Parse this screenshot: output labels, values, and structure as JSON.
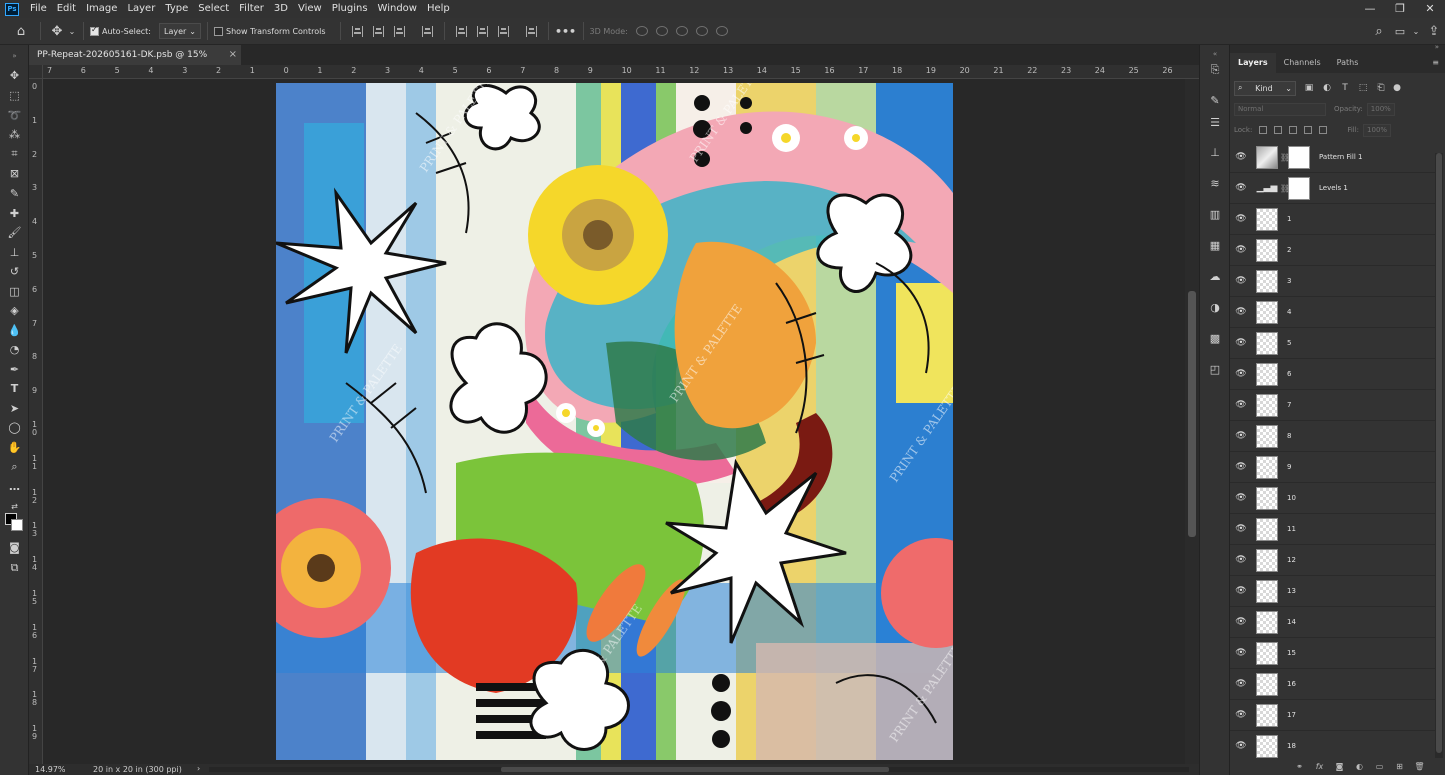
{
  "menu": {
    "logo": "Ps",
    "items": [
      "File",
      "Edit",
      "Image",
      "Layer",
      "Type",
      "Select",
      "Filter",
      "3D",
      "View",
      "Plugins",
      "Window",
      "Help"
    ],
    "window_controls": [
      "—",
      "❐",
      "✕"
    ]
  },
  "options_bar": {
    "auto_select_label": "Auto-Select:",
    "auto_select_checked": true,
    "auto_select_target": "Layer",
    "show_transform_label": "Show Transform Controls",
    "show_transform_checked": false,
    "mode_3d_label": "3D Mode:",
    "more_label": "•••"
  },
  "document": {
    "tab_title": "PP-Repeat-202605161-DK.psb @ 15% (RGB/8) *",
    "close_glyph": "×"
  },
  "rulers": {
    "top": [
      "7",
      "6",
      "5",
      "4",
      "3",
      "2",
      "1",
      "0",
      "1",
      "2",
      "3",
      "4",
      "5",
      "6",
      "7",
      "8",
      "9",
      "10",
      "11",
      "12",
      "13",
      "14",
      "15",
      "16",
      "17",
      "18",
      "19",
      "20",
      "21",
      "22",
      "23",
      "24",
      "25",
      "26"
    ],
    "left": [
      "0",
      "1",
      "2",
      "3",
      "4",
      "5",
      "6",
      "7",
      "8",
      "9",
      "1 0",
      "1 1",
      "1 2",
      "1 3",
      "1 4",
      "1 5",
      "1 6",
      "1 7",
      "1 8",
      "1 9"
    ]
  },
  "status": {
    "zoom": "14.97%",
    "doc_size": "20 in x 20 in (300 ppi)",
    "arrow": "›"
  },
  "layers_panel": {
    "tabs": [
      "Layers",
      "Channels",
      "Paths"
    ],
    "active_tab": "Layers",
    "kind_label": "Kind",
    "blend_mode": "Normal",
    "opacity_label": "Opacity:",
    "opacity_value": "100%",
    "lock_label": "Lock:",
    "fill_label": "Fill:",
    "fill_value": "100%",
    "layers": [
      {
        "name": "Pattern Fill 1",
        "kind": "pattern-fill"
      },
      {
        "name": "Levels 1",
        "kind": "adjustment"
      },
      {
        "name": "1",
        "kind": "pixel"
      },
      {
        "name": "2",
        "kind": "pixel"
      },
      {
        "name": "3",
        "kind": "pixel"
      },
      {
        "name": "4",
        "kind": "pixel"
      },
      {
        "name": "5",
        "kind": "pixel"
      },
      {
        "name": "6",
        "kind": "pixel"
      },
      {
        "name": "7",
        "kind": "pixel"
      },
      {
        "name": "8",
        "kind": "pixel"
      },
      {
        "name": "9",
        "kind": "pixel"
      },
      {
        "name": "10",
        "kind": "pixel"
      },
      {
        "name": "11",
        "kind": "pixel"
      },
      {
        "name": "12",
        "kind": "pixel"
      },
      {
        "name": "13",
        "kind": "pixel"
      },
      {
        "name": "14",
        "kind": "pixel"
      },
      {
        "name": "15",
        "kind": "pixel"
      },
      {
        "name": "16",
        "kind": "pixel"
      },
      {
        "name": "17",
        "kind": "pixel"
      },
      {
        "name": "18",
        "kind": "pixel"
      }
    ]
  },
  "artwork": {
    "watermark": "PRINT & PALETTE"
  },
  "colors": {
    "accent": "#31a8ff",
    "panel_bg": "#333333",
    "canvas_bg": "#282828"
  }
}
